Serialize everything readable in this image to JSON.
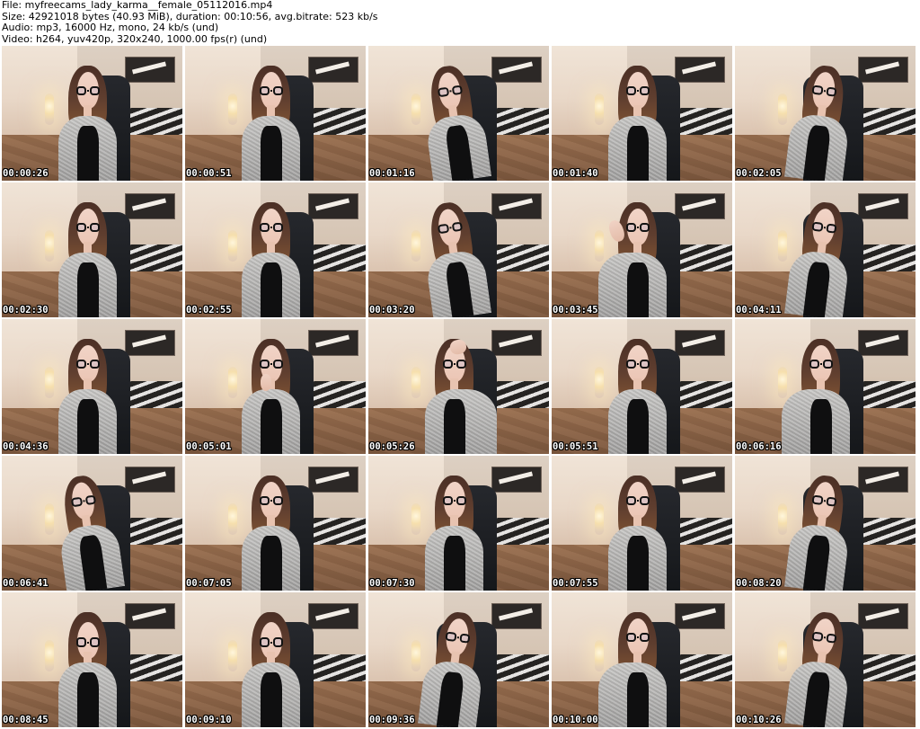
{
  "info": {
    "file": "File: myfreecams_lady_karma__female_05112016.mp4",
    "size": "Size: 42921018 bytes (40.93 MiB), duration: 00:10:56, avg.bitrate: 523 kb/s",
    "audio": "Audio: mp3, 16000 Hz, mono, 24 kb/s (und)",
    "video": "Video: h264, yuv420p, 320x240, 1000.00 fps(r) (und)"
  },
  "thumbnails": [
    {
      "timestamp": "00:00:26"
    },
    {
      "timestamp": "00:00:51"
    },
    {
      "timestamp": "00:01:16"
    },
    {
      "timestamp": "00:01:40"
    },
    {
      "timestamp": "00:02:05"
    },
    {
      "timestamp": "00:02:30"
    },
    {
      "timestamp": "00:02:55"
    },
    {
      "timestamp": "00:03:20"
    },
    {
      "timestamp": "00:03:45"
    },
    {
      "timestamp": "00:04:11"
    },
    {
      "timestamp": "00:04:36"
    },
    {
      "timestamp": "00:05:01"
    },
    {
      "timestamp": "00:05:26"
    },
    {
      "timestamp": "00:05:51"
    },
    {
      "timestamp": "00:06:16"
    },
    {
      "timestamp": "00:06:41"
    },
    {
      "timestamp": "00:07:05"
    },
    {
      "timestamp": "00:07:30"
    },
    {
      "timestamp": "00:07:55"
    },
    {
      "timestamp": "00:08:20"
    },
    {
      "timestamp": "00:08:45"
    },
    {
      "timestamp": "00:09:10"
    },
    {
      "timestamp": "00:09:36"
    },
    {
      "timestamp": "00:10:00"
    },
    {
      "timestamp": "00:10:26"
    }
  ]
}
